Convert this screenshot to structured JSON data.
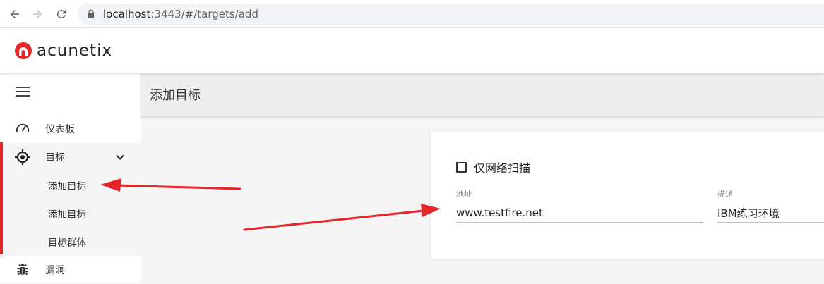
{
  "browser": {
    "url_host": "localhost",
    "url_rest": ":3443/#/targets/add"
  },
  "app": {
    "logo_text": "acunetix",
    "brand_color": "#e3262a"
  },
  "sidebar": {
    "items": [
      {
        "label": "仪表板",
        "icon": "gauge-icon"
      },
      {
        "label": "目标",
        "icon": "crosshair-icon"
      },
      {
        "label": "漏洞",
        "icon": "bug-icon"
      }
    ],
    "subitems": [
      {
        "label": "添加目标"
      },
      {
        "label": "添加目标"
      },
      {
        "label": "目标群体"
      }
    ]
  },
  "page": {
    "title": "添加目标"
  },
  "form": {
    "checkbox_label": "仅网络扫描",
    "checkbox_checked": false,
    "address_label": "地址",
    "address_value": "www.testfire.net",
    "description_label": "描述",
    "description_value": "IBM练习环境"
  }
}
